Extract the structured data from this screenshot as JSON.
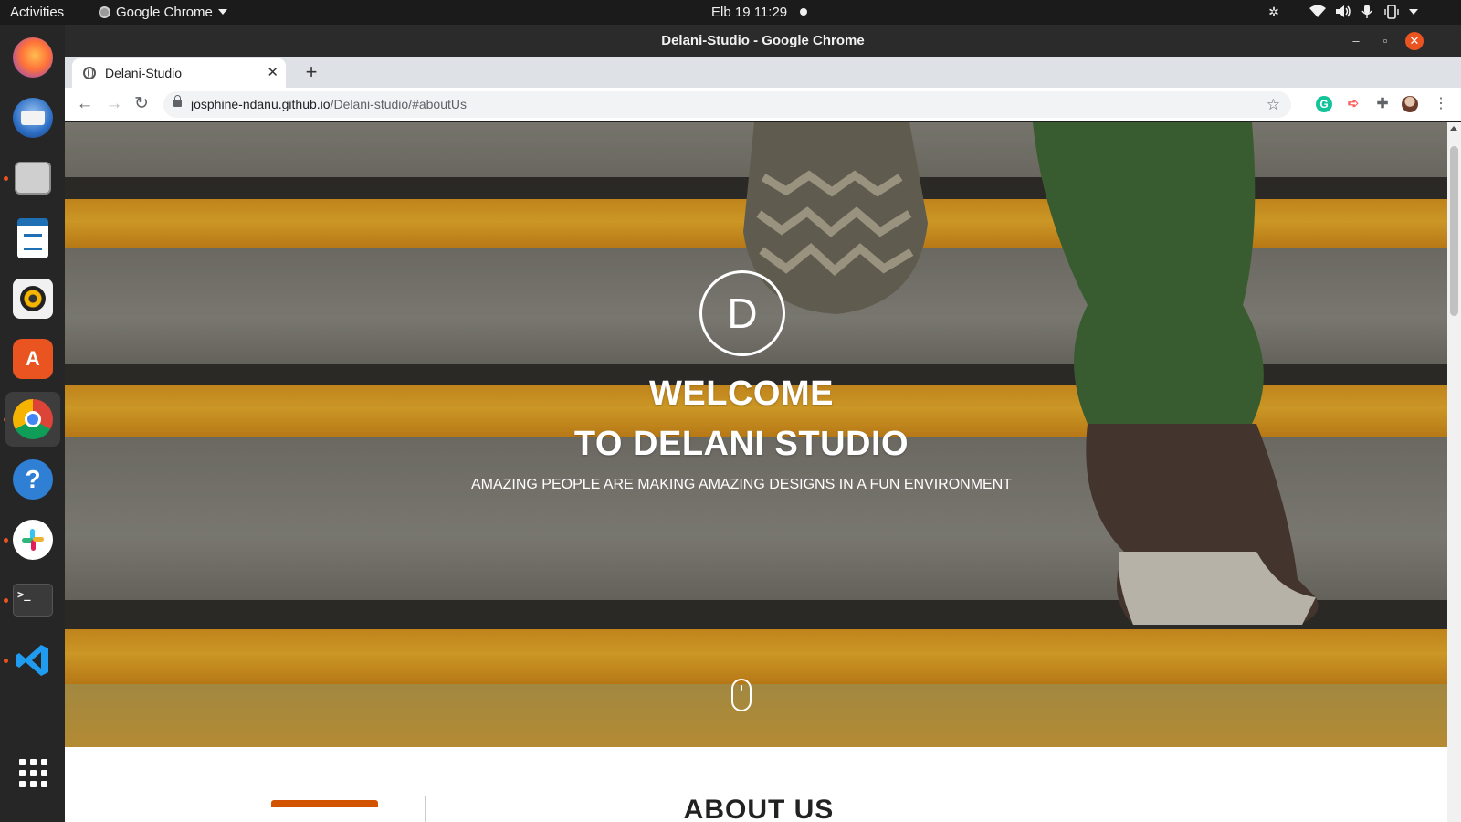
{
  "topbar": {
    "activities": "Activities",
    "app_name": "Google Chrome",
    "datetime": "Elb 19  11:29"
  },
  "dock": {
    "apps": [
      "firefox-icon",
      "thunderbird-icon",
      "files-icon",
      "writer-icon",
      "rhythmbox-icon",
      "software-icon",
      "chrome-icon",
      "help-icon",
      "slack-icon",
      "terminal-icon",
      "vscode-icon",
      "app-grid-icon"
    ]
  },
  "window": {
    "title": "Delani-Studio - Google Chrome"
  },
  "tab": {
    "title": "Delani-Studio"
  },
  "omnibox": {
    "host": "josphine-ndanu.github.io",
    "path": "/Delani-studio/#aboutUs"
  },
  "hero": {
    "logo_letter": "D",
    "title_line1": "WELCOME",
    "title_line2": "TO DELANI STUDIO",
    "subtitle": "AMAZING PEOPLE ARE MAKING AMAZING DESIGNS IN A FUN ENVIRONMENT"
  },
  "about": {
    "title": "ABOUT US"
  },
  "colors": {
    "accent": "#e95420",
    "stripe": "#f2b22a",
    "about_accent": "#d35400"
  }
}
